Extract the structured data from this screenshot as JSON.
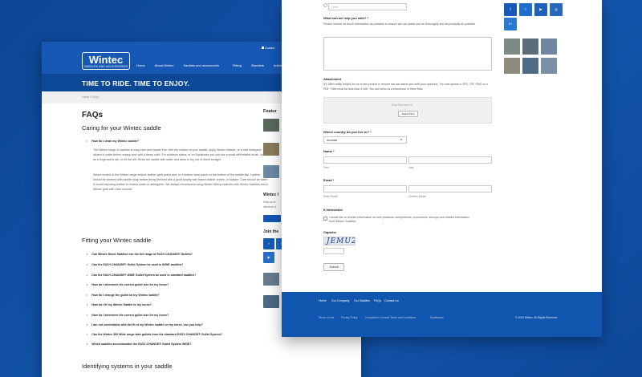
{
  "left_page": {
    "logo": {
      "main": "Wintec",
      "sub": "SADDLES AND ACCESSORIES"
    },
    "nav": [
      "Home",
      "About Wintec",
      "Saddles and accessories",
      "Fitting",
      "Stockists",
      "Articles",
      "FAQs"
    ],
    "contact": "Contact",
    "banner": "TIME TO RIDE. TIME TO ENJOY.",
    "breadcrumb": "Home / FAQs",
    "page_title": "FAQs",
    "section1": {
      "heading": "Caring for your Wintec saddle",
      "question": "How do I clean my Wintec saddle?",
      "para1": "The Wintec range of saddles is easy-care and hassle free. Wet the surface of your saddle; apply Wintec cleaner, or a mild detergent diluted in water before wiping over with a damp cloth. For stubborn stains, or on Equisuede you can use a small stiff bristled brush, such as a fingernail brush, to lift the dirt. Rinse the saddle with water and allow to dry out of direct sunlight.",
      "para2": "Select models in the Wintec range feature leather girth points and, or a leather wear patch on the bottom of the saddle flap. Leather should be cleaned with saddle soap before being dressed with a good quality wax based leather cream, or balsam. Care should be taken to avoid exposing leather to excess water or detergents. We always recommend using Wintec Stirrup leathers with Wintec Saddles and a Wintec girth with roller buckles"
    },
    "section2": {
      "heading": "Fitting your Wintec saddle",
      "questions": [
        "Can Wintec Stock Saddles use the full range of EASY-CHANGE® Gullets?",
        "Can the EASY-CHANGE® Gullet System be used in WIDE saddles?",
        "Can the EASY-CHANGE® WIDE Gullet System be used in standard saddles?",
        "How do I determine the correct gullet size for my horse?",
        "How do I change the gullet on my Wintec saddle?",
        "How do I fit my Wintec Saddle to my horse?",
        "How do I determine the correct gullet size for my horse?",
        "I am not comfortable with the fit of my Wintec saddle on my horse, can you help?",
        "Can the Wintec 500 Wide range take gullets from the standard EASY-CHANGE® Gullet System?",
        "Which saddles accommodate the EASY-CHANGE® Gullet System WIDE?"
      ]
    },
    "section3": {
      "heading": "Identifying systems in your saddle"
    },
    "sidebar": {
      "featured": "Featur",
      "newsletter_heading": "Wintec l",
      "newsletter_text": [
        "Keep up to",
        "delivered d"
      ],
      "join_heading": "Join the",
      "social": [
        "f",
        "t",
        "▶"
      ]
    }
  },
  "right_page": {
    "other_placeholder": "Other",
    "help_label": "What can we help you with? *",
    "help_hint": "Please include as much information as possible to ensure we can assist you as thoroughly and as promptly as possible.",
    "attachment_label": "Attachment",
    "attachment_hint": "It's often really helpful for us to see photos to ensure we can assist you with your question. You can upload a JPG, GIF, PNG or a PDF. Files must be less than 5 MB. You can send us a maximum of three files.",
    "drop_text": "Drop files here or",
    "select_button": "Select Files",
    "country_label": "Which country do you live in? *",
    "country_value": "Australia",
    "name_label": "Name *",
    "first_label": "First",
    "last_label": "Last",
    "email_label": "Email *",
    "enter_email": "Enter Email",
    "confirm_email": "Confirm Email",
    "newsletter_label": "E-Newsletter",
    "newsletter_text": "I would like to receive information on new products, competitions, promotions, surveys and related information from Wintec Saddles.",
    "captcha_label": "Captcha",
    "captcha_text": "JEMU2",
    "submit": "Submit",
    "social": [
      "f",
      "t",
      "▶",
      "◎",
      "in"
    ],
    "footer_links": [
      "Home",
      "Our Company",
      "Our Saddles",
      "FAQs",
      "Contact Us"
    ],
    "footer_links2": [
      "Terms of Use",
      "Privacy Policy",
      "Competition General Terms and Conditions",
      "Distributors"
    ],
    "copyright": "© 2015 Wintec. All Rights Reserved."
  },
  "colors": {
    "brand_blue": "#1658b4",
    "footer_blue": "#1156ae"
  }
}
